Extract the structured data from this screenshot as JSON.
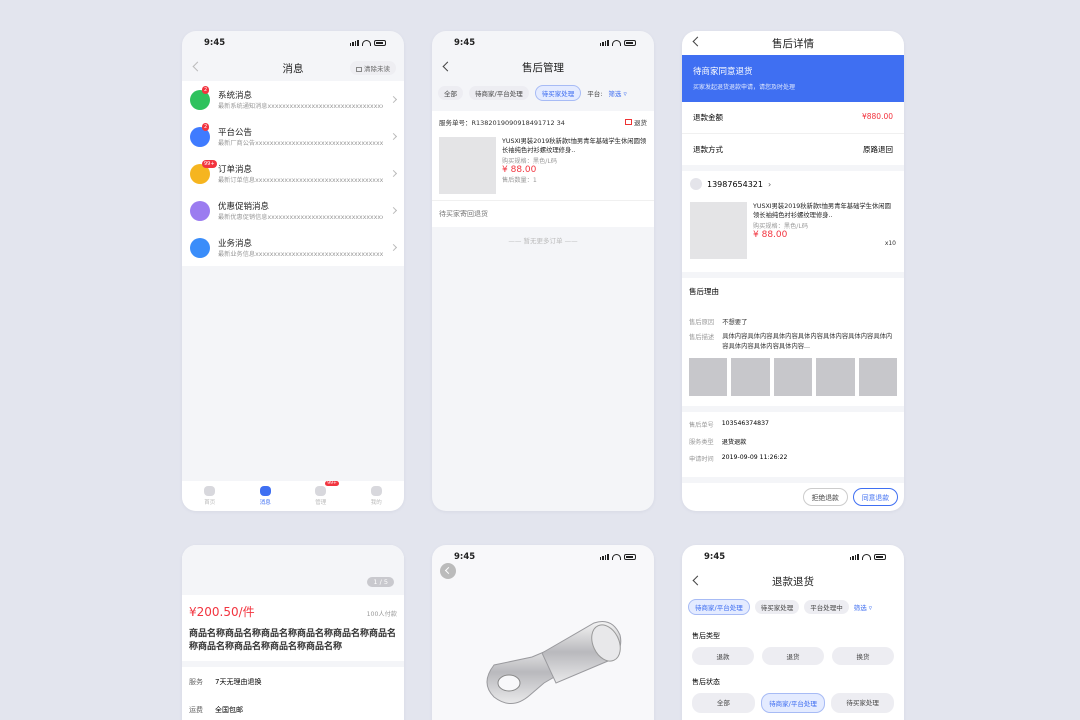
{
  "time": "9:45",
  "msg": {
    "title": "消息",
    "clear": "清除未读",
    "items": [
      {
        "t": "系统消息",
        "s": "最新系统通知消息xxxxxxxxxxxxxxxxxxxxxxxxxxxxxxxx",
        "b": "2",
        "c": "#2ec25d"
      },
      {
        "t": "平台公告",
        "s": "最新厂商公告xxxxxxxxxxxxxxxxxxxxxxxxxxxxxxxxxxxx",
        "b": "2",
        "c": "#3f7bff"
      },
      {
        "t": "订单消息",
        "s": "最新订单信息xxxxxxxxxxxxxxxxxxxxxxxxxxxxxxxxxxxx",
        "b": "99+",
        "c": "#f6b51f"
      },
      {
        "t": "优惠促销消息",
        "s": "最新优惠促销信息xxxxxxxxxxxxxxxxxxxxxxxxxxxxxxxx",
        "b": "",
        "c": "#9b7cf0"
      },
      {
        "t": "业务消息",
        "s": "最新业务信息xxxxxxxxxxxxxxxxxxxxxxxxxxxxxxxxxxxx",
        "b": "",
        "c": "#3a8dfa"
      }
    ],
    "tabs": [
      {
        "l": "首页"
      },
      {
        "l": "消息"
      },
      {
        "l": "管理",
        "b": "99+"
      },
      {
        "l": "我的"
      }
    ]
  },
  "after": {
    "title": "售后管理",
    "filters": [
      "全部",
      "待商家/平台处理",
      "待买家处理",
      "平台:"
    ],
    "filter_btn": "筛选",
    "order_no": "服务单号：R1382019090918491712 34",
    "tag": "退货",
    "prod": "YUSXI男装2019秋新款t恤男青年基础学生休闲圆领长袖纯色衬衫螺纹理修身..",
    "spec": "购买规格：黑色/L码",
    "price": "¥ 88.00",
    "qty": "售后数量：1",
    "status": "待买家寄回退货",
    "nomore": "暂无更多订单"
  },
  "detail": {
    "title": "售后详情",
    "banner": "待商家同意退货",
    "banner_sub": "买家发起退货退款申请，请您及时处理",
    "amount_l": "退款金额",
    "amount_v": "¥880.00",
    "method_l": "退款方式",
    "method_v": "原路退回",
    "phone": "13987654321",
    "prod": "YUSXI男装2019秋新款t恤男青年基础学生休闲圆领长袖纯色衬衫螺纹理修身..",
    "spec": "购买规格：黑色/L码",
    "price": "¥ 88.00",
    "qty": "x10",
    "reason_h": "售后理由",
    "r_l": "售后原因",
    "r_v": "不想要了",
    "d_l": "售后描述",
    "d_v": "具体内容具体内容具体内容具体内容具体内容具体内容具体内容具体内容具体内容具体内容...",
    "info": [
      [
        "售后单号",
        "103546374837"
      ],
      [
        "服务类型",
        "退货退款"
      ],
      [
        "申请时间",
        "2019-09-09 11:26:22"
      ]
    ],
    "reject": "拒绝退款",
    "agree": "同意退款"
  },
  "goods": {
    "pager": "1 / 5",
    "price": "¥200.50/件",
    "sold": "100人付款",
    "name": "商品名称商品名称商品名称商品名称商品名称商品名称商品名称商品名称商品名称商品名称",
    "svc_l": "服务",
    "svc_v": "7天无理由退换",
    "ship_l": "运费",
    "ship_v": "全国包邮"
  },
  "refund": {
    "title": "退款退货",
    "filters": [
      "待商家/平台处理",
      "待买家处理",
      "平台处理中"
    ],
    "filter_btn": "筛选",
    "type_h": "售后类型",
    "types": [
      "退款",
      "退货",
      "换货"
    ],
    "state_h": "售后状态",
    "states": [
      "全部",
      "待商家/平台处理",
      "待买家处理"
    ]
  }
}
